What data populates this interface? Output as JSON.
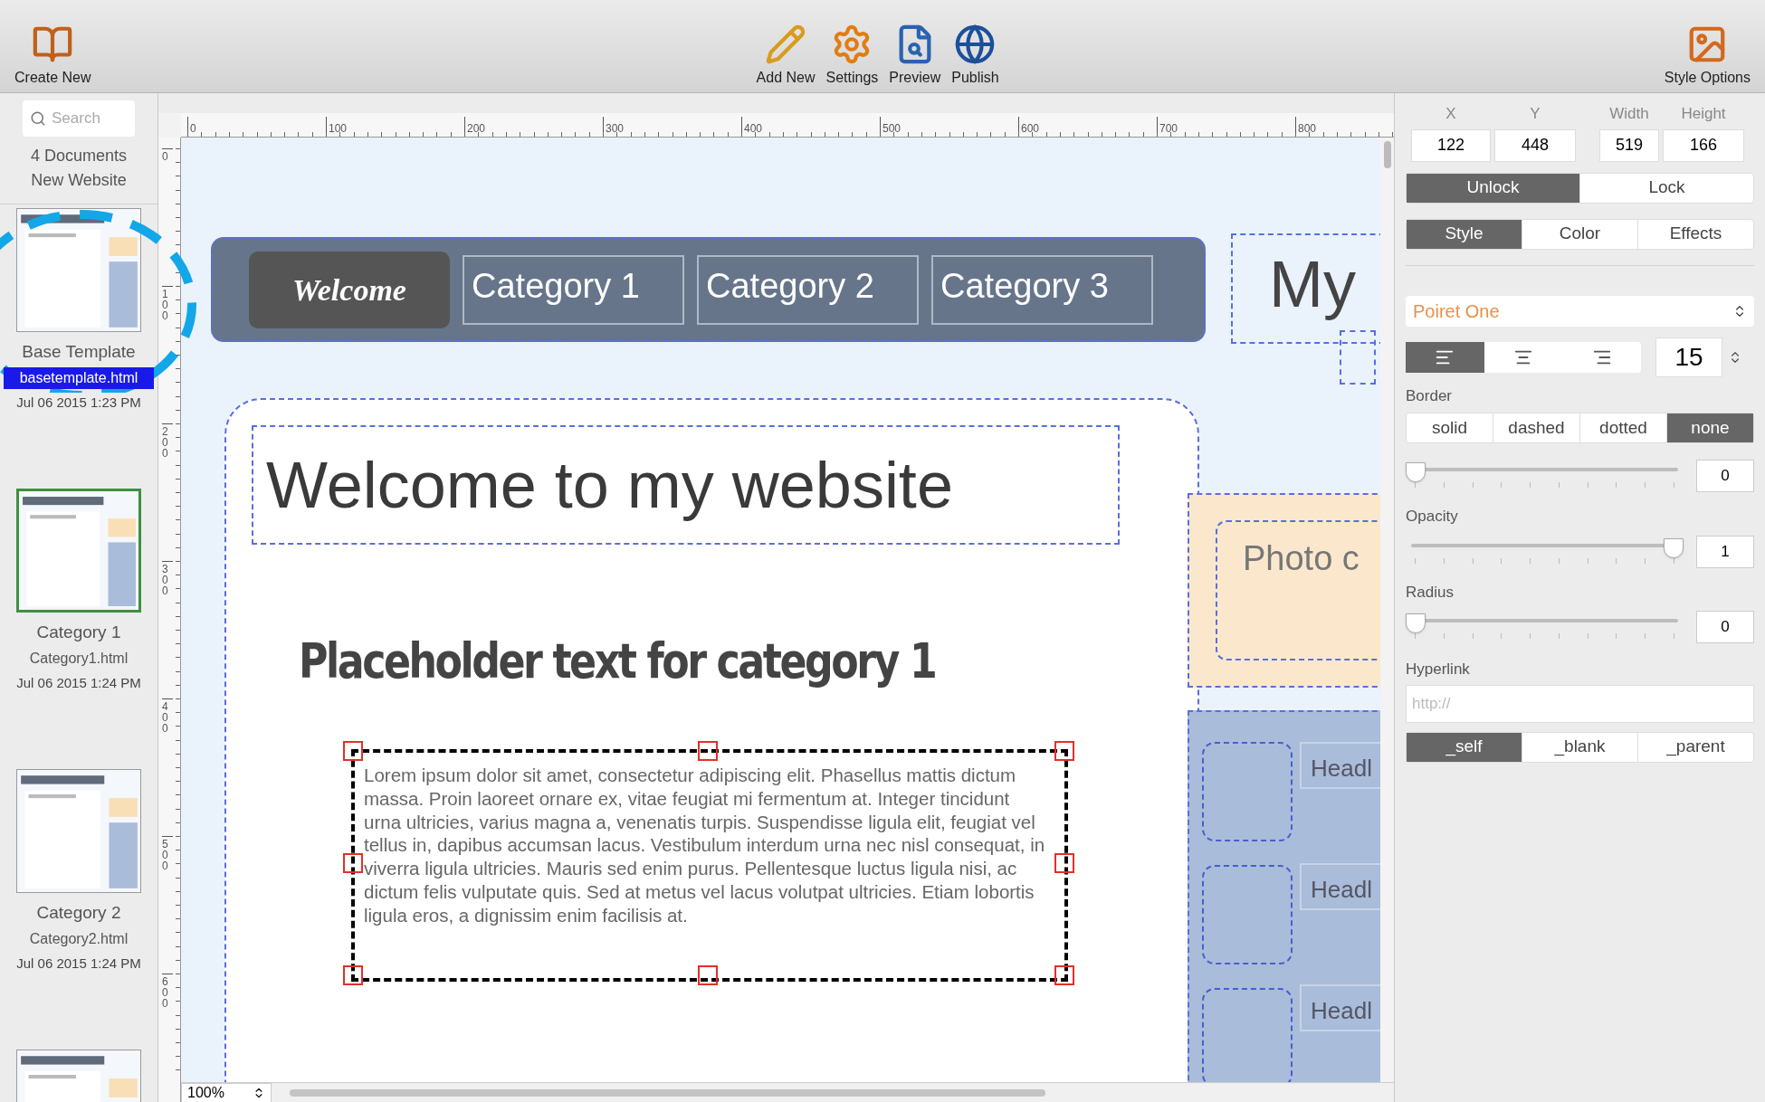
{
  "toolbar": {
    "left": [
      {
        "label": "Create New"
      }
    ],
    "center": [
      {
        "label": "Add New"
      },
      {
        "label": "Settings"
      },
      {
        "label": "Preview"
      },
      {
        "label": "Publish"
      }
    ],
    "right": [
      {
        "label": "Style Options"
      }
    ]
  },
  "sidebar": {
    "search": {
      "placeholder": "Search"
    },
    "count": "4 Documents",
    "project": "New Website",
    "documents": [
      {
        "kind": "full",
        "name": "Base Template",
        "file": "basetemplate.html",
        "date": "Jul 06 2015 1:23 PM",
        "selected": true,
        "current": false
      },
      {
        "kind": "full",
        "name": "Category 1",
        "file": "Category1.html",
        "date": "Jul 06 2015 1:24 PM",
        "selected": false,
        "current": true
      },
      {
        "kind": "full",
        "name": "Category 2",
        "file": "Category2.html",
        "date": "Jul 06 2015 1:24 PM",
        "selected": false,
        "current": false
      },
      {
        "kind": "partial",
        "current": false
      }
    ]
  },
  "rulers": {
    "horizontal": [
      "0",
      "100",
      "200",
      "300",
      "400",
      "500",
      "600",
      "700",
      "800"
    ],
    "vertical": [
      "0",
      "100",
      "200",
      "300",
      "400",
      "500",
      "600"
    ]
  },
  "canvas": {
    "nav": [
      {
        "label": "Welcome",
        "selected": true
      },
      {
        "label": "Category 1",
        "selected": false
      },
      {
        "label": "Category 2",
        "selected": false
      },
      {
        "label": "Category 3",
        "selected": false
      }
    ],
    "site_title": "My",
    "heading": "Welcome to my website",
    "subheading": "Placeholder text for category 1",
    "paragraph": "Lorem ipsum dolor sit amet, consectetur adipiscing elit. Phasellus mattis dictum massa. Proin laoreet ornare ex, vitae feugiat mi fermentum at. Integer tincidunt urna ultricies, varius magna a, venenatis turpis. Suspendisse ligula elit, feugiat vel tellus in, dapibus accumsan lacus. Vestibulum interdum urna nec nisl consequat, in viverra ligula ultricies. Mauris sed enim purus. Pellentesque luctus ligula nisi, ac dictum felis vulputate quis. Sed at metus vel lacus volutpat ultricies. Etiam lobortis ligula eros, a dignissim enim facilisis at.",
    "photo": "Photo c",
    "headlines": [
      "Headl",
      "Headl",
      "Headl"
    ],
    "zoom": "100%"
  },
  "inspector": {
    "fields": [
      {
        "label": "X",
        "value": "122"
      },
      {
        "label": "Y",
        "value": "448"
      },
      {
        "label": "Width",
        "value": "519"
      },
      {
        "label": "Height",
        "value": "166"
      }
    ],
    "lock": [
      {
        "label": "Unlock",
        "selected": true
      },
      {
        "label": "Lock",
        "selected": false
      }
    ],
    "tabs": [
      {
        "label": "Style",
        "selected": true
      },
      {
        "label": "Color",
        "selected": false
      },
      {
        "label": "Effects",
        "selected": false
      }
    ],
    "font": "Poiret One",
    "align": [
      {
        "kind": "left",
        "selected": true
      },
      {
        "kind": "center",
        "selected": false
      },
      {
        "kind": "right",
        "selected": false
      }
    ],
    "font_size": "15",
    "border_label": "Border",
    "border": [
      {
        "label": "solid",
        "selected": false
      },
      {
        "label": "dashed",
        "selected": false
      },
      {
        "label": "dotted",
        "selected": false
      },
      {
        "label": "none",
        "selected": true
      }
    ],
    "sliders": [
      {
        "level": 0,
        "reading": "0"
      },
      {
        "label": "Opacity",
        "level": 1,
        "reading": "1"
      },
      {
        "label": "Radius",
        "level": 0,
        "reading": "0"
      }
    ],
    "hyperlink_label": "Hyperlink",
    "hyperlink": {
      "placeholder": "http://"
    },
    "targets": [
      {
        "label": "_self",
        "selected": true
      },
      {
        "label": "_blank",
        "selected": false
      },
      {
        "label": "_parent",
        "selected": false
      }
    ]
  }
}
